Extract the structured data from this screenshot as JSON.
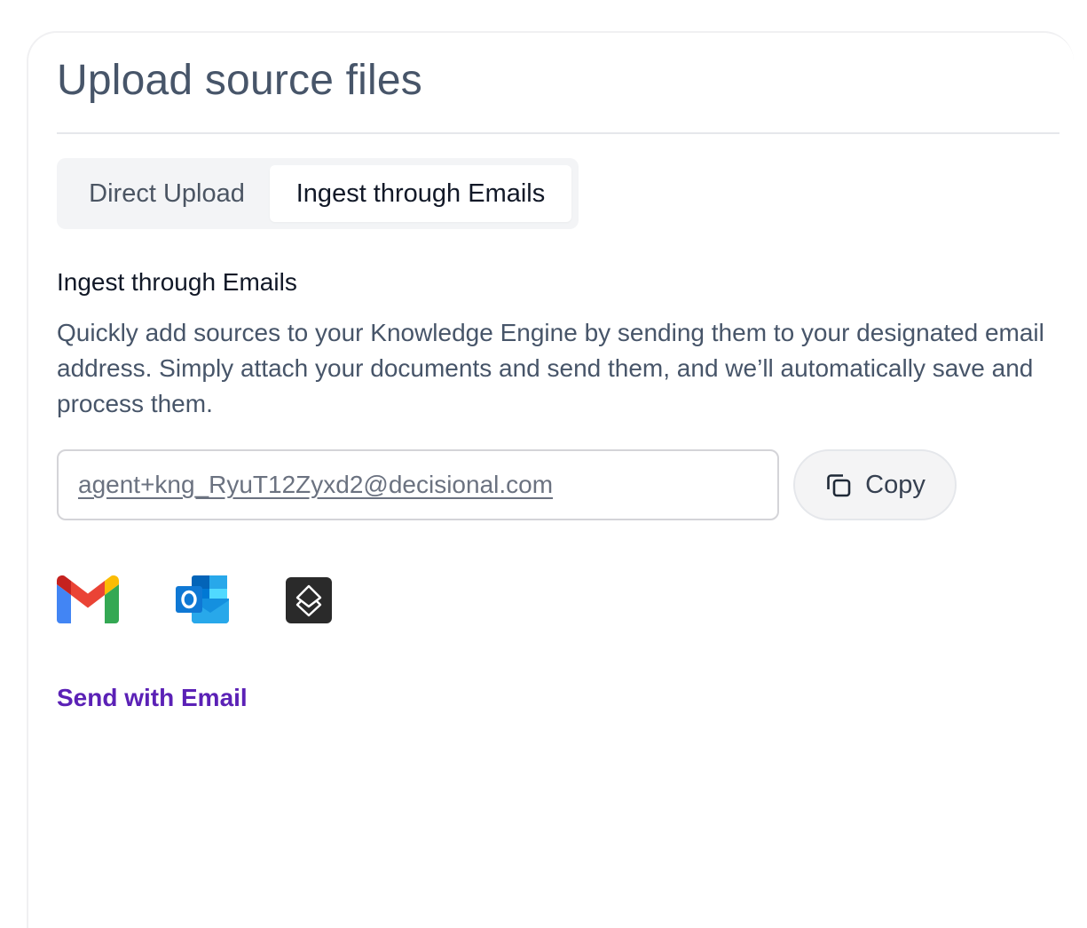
{
  "header": {
    "title": "Upload source files"
  },
  "tabs": [
    {
      "label": "Direct Upload",
      "active": false
    },
    {
      "label": "Ingest through Emails",
      "active": true
    }
  ],
  "section": {
    "heading": "Ingest through Emails",
    "description": "Quickly add sources to your Knowledge Engine by sending them to your designated email address. Simply attach your documents and send them, and we’ll automatically save and process them."
  },
  "email": {
    "address": "agent+kng_RyuT12Zyxd2@decisional.com",
    "copy_label": "Copy"
  },
  "clients": [
    {
      "name": "gmail-icon"
    },
    {
      "name": "outlook-icon"
    },
    {
      "name": "superhuman-icon"
    }
  ],
  "send_link": "Send with Email",
  "colors": {
    "accent": "#5b21b6",
    "title": "#475569",
    "tab_bg": "#f3f4f6"
  }
}
